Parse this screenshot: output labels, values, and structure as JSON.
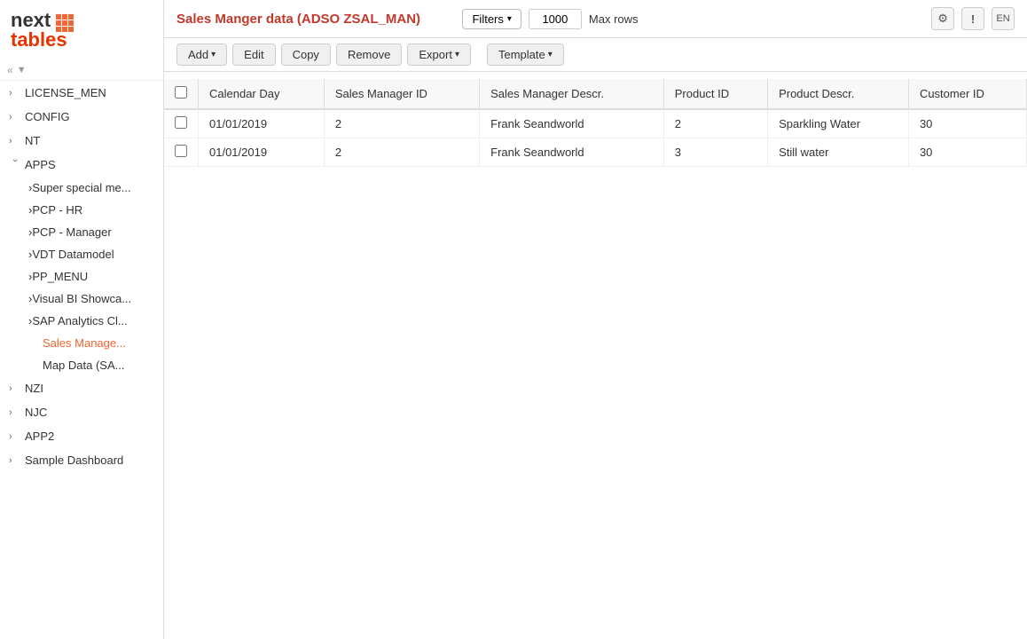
{
  "logo": {
    "line1": "next",
    "line2": "tables"
  },
  "header": {
    "title": "Sales Manger data (ADSO ZSAL_MAN)",
    "filters_label": "Filters",
    "max_rows_value": "1000",
    "max_rows_label": "Max rows"
  },
  "toolbar": {
    "add_label": "Add",
    "edit_label": "Edit",
    "copy_label": "Copy",
    "remove_label": "Remove",
    "export_label": "Export",
    "template_label": "Template"
  },
  "table": {
    "columns": [
      "Calendar Day",
      "Sales Manager ID",
      "Sales Manager Descr.",
      "Product ID",
      "Product Descr.",
      "Customer ID"
    ],
    "rows": [
      {
        "calendar_day": "01/01/2019",
        "sales_manager_id": "2",
        "sales_manager_descr": "Frank Seandworld",
        "product_id": "2",
        "product_descr": "Sparkling Water",
        "customer_id": "30"
      },
      {
        "calendar_day": "01/01/2019",
        "sales_manager_id": "2",
        "sales_manager_descr": "Frank Seandworld",
        "product_id": "3",
        "product_descr": "Still water",
        "customer_id": "30"
      }
    ]
  },
  "sidebar": {
    "items": [
      {
        "id": "license_men",
        "label": "LICENSE_MEN",
        "expanded": false
      },
      {
        "id": "config",
        "label": "CONFIG",
        "expanded": false
      },
      {
        "id": "nt",
        "label": "NT",
        "expanded": false
      },
      {
        "id": "apps",
        "label": "APPS",
        "expanded": true,
        "children": [
          {
            "id": "super_special",
            "label": "Super special me...",
            "active": false
          },
          {
            "id": "pcp_hr",
            "label": "PCP - HR",
            "active": false
          },
          {
            "id": "pcp_manager",
            "label": "PCP - Manager",
            "active": false
          },
          {
            "id": "vdt_datamodel",
            "label": "VDT Datamodel",
            "active": false
          },
          {
            "id": "pp_menu",
            "label": "PP_MENU",
            "active": false
          },
          {
            "id": "visual_bi",
            "label": "Visual BI Showca...",
            "active": false
          },
          {
            "id": "sap_analytics",
            "label": "SAP Analytics Cl...",
            "expanded": true,
            "children": [
              {
                "id": "sales_manager",
                "label": "Sales Manage...",
                "active": true
              },
              {
                "id": "map_data",
                "label": "Map Data (SA...",
                "active": false
              }
            ]
          }
        ]
      },
      {
        "id": "nzi",
        "label": "NZI",
        "expanded": false
      },
      {
        "id": "njc",
        "label": "NJC",
        "expanded": false
      },
      {
        "id": "app2",
        "label": "APP2",
        "expanded": false
      },
      {
        "id": "sample_dashboard",
        "label": "Sample Dashboard",
        "expanded": false
      }
    ]
  }
}
